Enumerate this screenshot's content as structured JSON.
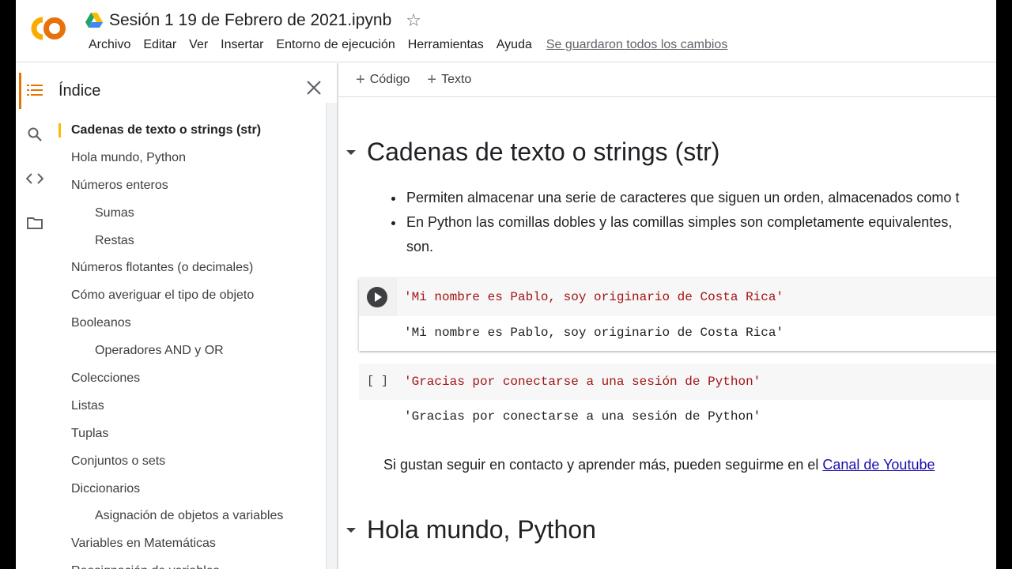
{
  "app": {
    "logo_text": "CO",
    "doc_title": "Sesión 1 19 de Febrero de 2021.ipynb",
    "menu": [
      "Archivo",
      "Editar",
      "Ver",
      "Insertar",
      "Entorno de ejecución",
      "Herramientas",
      "Ayuda"
    ],
    "save_status": "Se guardaron todos los cambios"
  },
  "toc": {
    "title": "Índice",
    "items": [
      {
        "label": "Cadenas de texto o strings (str)",
        "level": 1,
        "active": true
      },
      {
        "label": "Hola mundo, Python",
        "level": 1
      },
      {
        "label": "Números enteros",
        "level": 1
      },
      {
        "label": "Sumas",
        "level": 2
      },
      {
        "label": "Restas",
        "level": 2
      },
      {
        "label": "Números flotantes (o decimales)",
        "level": 1
      },
      {
        "label": "Cómo averiguar el tipo de objeto",
        "level": 1
      },
      {
        "label": "Booleanos",
        "level": 1
      },
      {
        "label": "Operadores AND y OR",
        "level": 2
      },
      {
        "label": "Colecciones",
        "level": 1
      },
      {
        "label": "Listas",
        "level": 1
      },
      {
        "label": "Tuplas",
        "level": 1
      },
      {
        "label": "Conjuntos o sets",
        "level": 1
      },
      {
        "label": "Diccionarios",
        "level": 1
      },
      {
        "label": "Asignación de objetos a variables",
        "level": 2
      },
      {
        "label": "Variables en Matemáticas",
        "level": 1
      },
      {
        "label": "Reasignación de variables",
        "level": 1
      }
    ]
  },
  "toolbar": {
    "add_code": "Código",
    "add_text": "Texto"
  },
  "notebook": {
    "section1_title": "Cadenas de texto o strings (str)",
    "bullet1": "Permiten almacenar una serie de caracteres que siguen un orden, almacenados como t",
    "bullet2_line1": "En Python las comillas dobles y las comillas simples son completamente equivalentes,",
    "bullet2_line2": "son.",
    "cell1_code": "'Mi nombre es Pablo, soy originario de Costa Rica'",
    "cell1_output": "'Mi nombre es Pablo, soy originario de Costa Rica'",
    "cell2_bracket": "[ ]",
    "cell2_code": "'Gracias por conectarse a una sesión de Python'",
    "cell2_output": "'Gracias por conectarse a una sesión de Python'",
    "contact_text": "Si gustan seguir en contacto y aprender más, pueden seguirme en el ",
    "contact_link": "Canal de Youtube",
    "section2_title": "Hola mundo, Python"
  },
  "colors": {
    "accent_orange": "#e37400",
    "toc_marker": "#fbbc04",
    "string_red": "#a31515",
    "link_blue": "#1a0dab"
  }
}
